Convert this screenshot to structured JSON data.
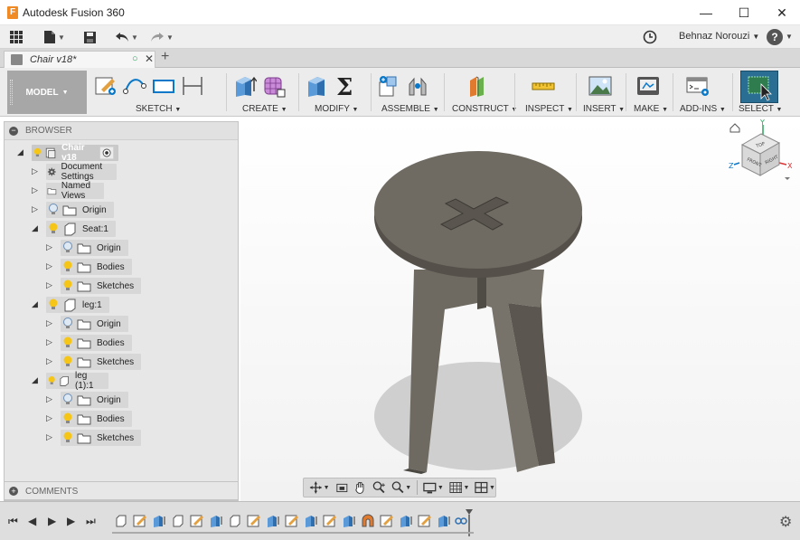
{
  "window": {
    "app_title": "Autodesk Fusion 360",
    "app_icon_glyph": "F",
    "minimize": "—",
    "maximize": "☐",
    "close": "✕"
  },
  "qat": {
    "user_name": "Behnaz Norouzi",
    "help": "?"
  },
  "tab": {
    "label": "Chair v18*",
    "new_tab": "+"
  },
  "ribbon": {
    "workspace": "MODEL",
    "groups": [
      "SKETCH",
      "CREATE",
      "MODIFY",
      "ASSEMBLE",
      "CONSTRUCT",
      "INSPECT",
      "INSERT",
      "MAKE",
      "ADD-INS",
      "SELECT"
    ]
  },
  "browser": {
    "title": "BROWSER",
    "root": "Chair v18",
    "items": {
      "document_settings": "Document Settings",
      "named_views": "Named Views",
      "origin": "Origin",
      "seat": "Seat:1",
      "seat_origin": "Origin",
      "seat_bodies": "Bodies",
      "seat_sketches": "Sketches",
      "leg": "leg:1",
      "leg_origin": "Origin",
      "leg_bodies": "Bodies",
      "leg_sketches": "Sketches",
      "leg2": "leg (1):1",
      "leg2_origin": "Origin",
      "leg2_bodies": "Bodies",
      "leg2_sketches": "Sketches"
    }
  },
  "comments": {
    "title": "COMMENTS"
  },
  "viewcube": {
    "front": "FRONT",
    "right": "RIGHT",
    "top": "TOP",
    "axis_x": "X",
    "axis_y": "Y",
    "axis_z": "Z"
  },
  "colors": {
    "accent_blue": "#0a78c8",
    "bulb_yellow": "#f5c518",
    "model_gray": "#6e6a62",
    "select_green": "#2f7d4f"
  }
}
